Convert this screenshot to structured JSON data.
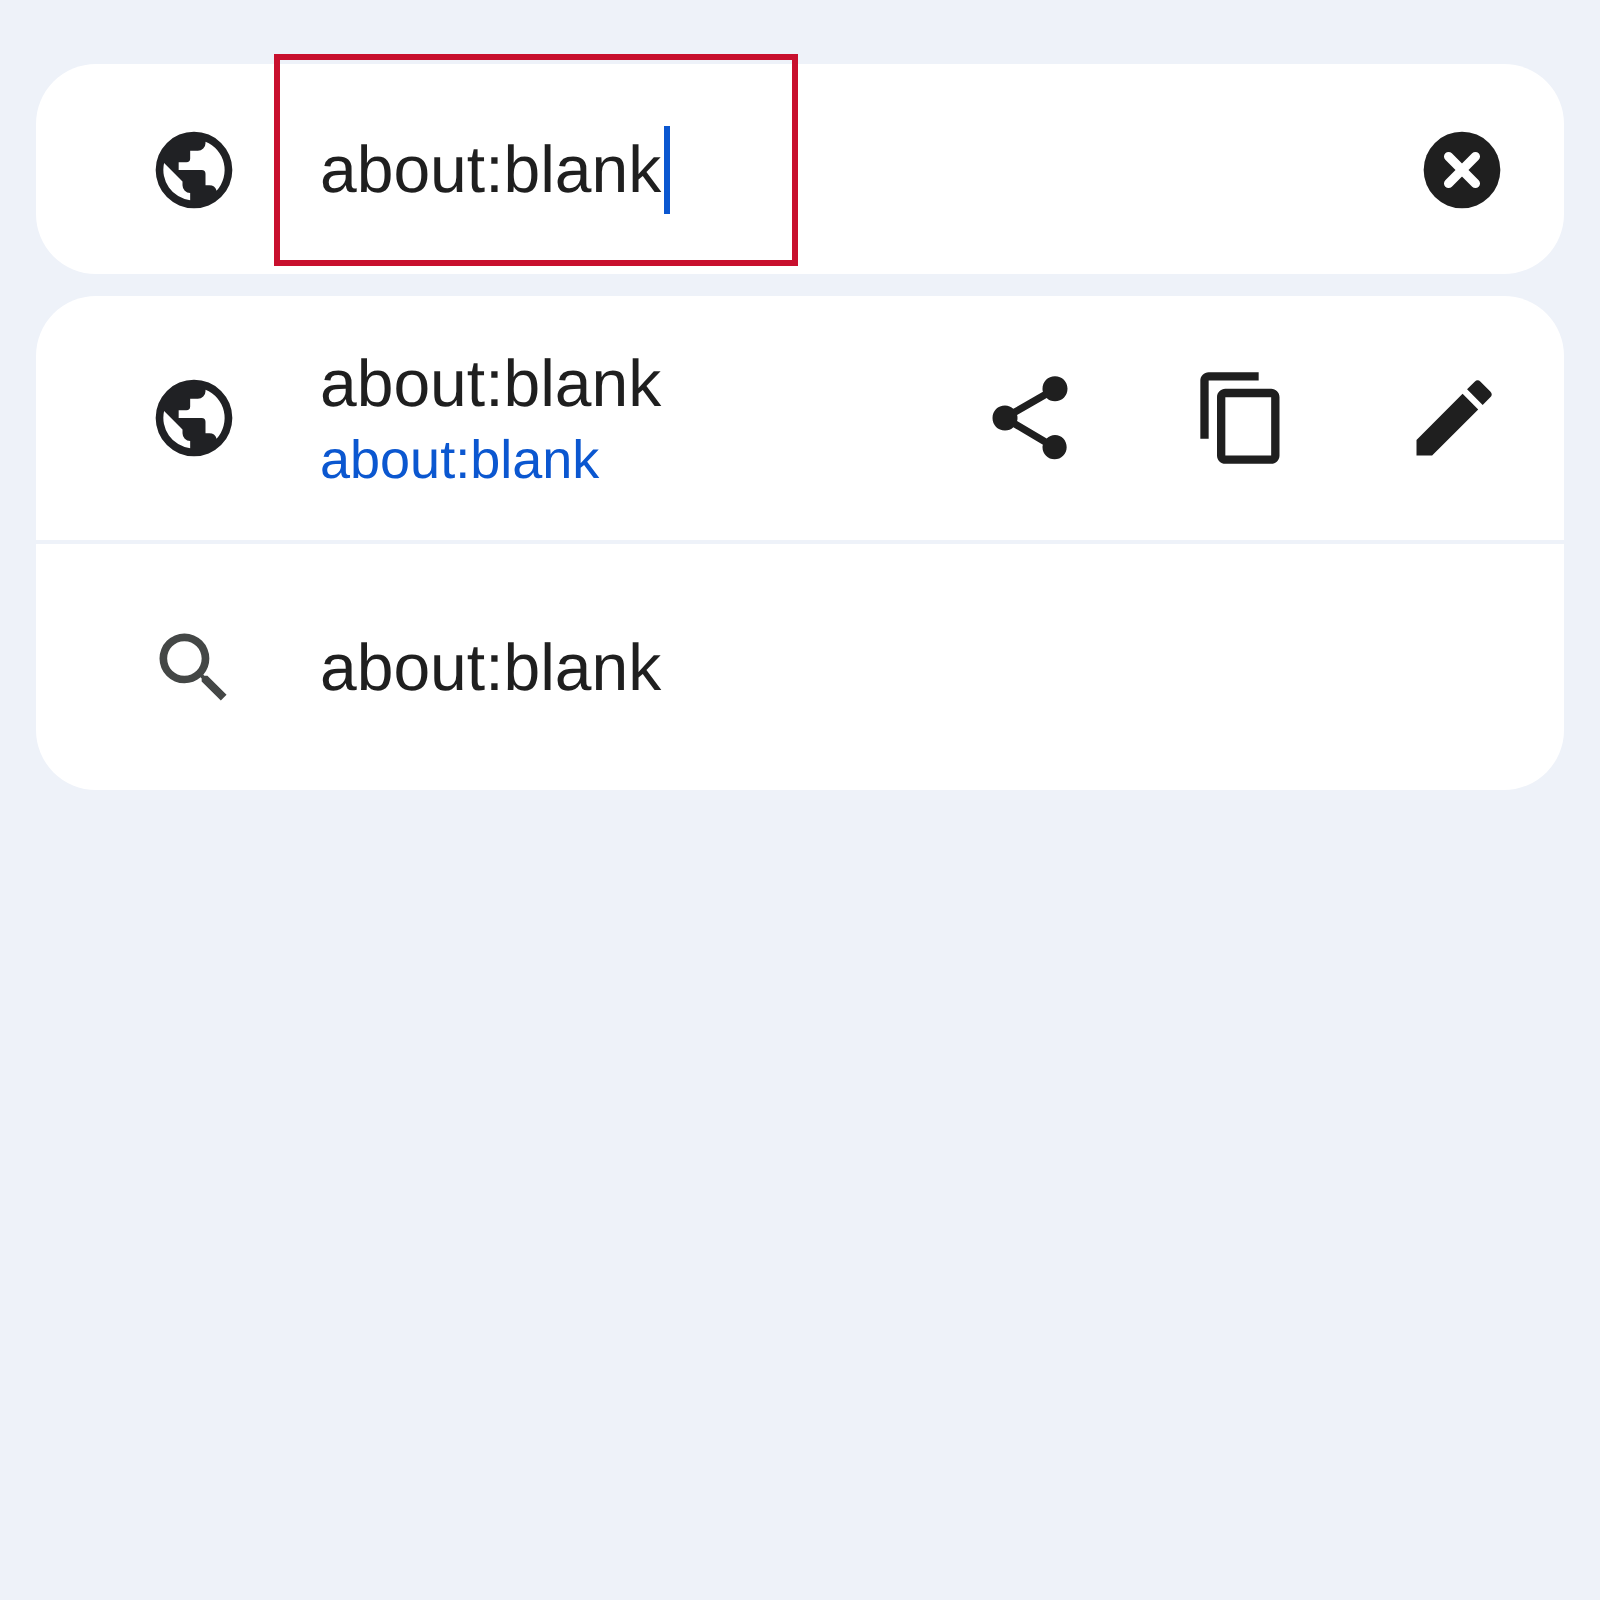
{
  "omnibox": {
    "value": "about:blank",
    "highlighted": true
  },
  "suggestions": [
    {
      "kind": "url",
      "title": "about:blank",
      "url": "about:blank"
    },
    {
      "kind": "search",
      "title": "about:blank"
    }
  ]
}
